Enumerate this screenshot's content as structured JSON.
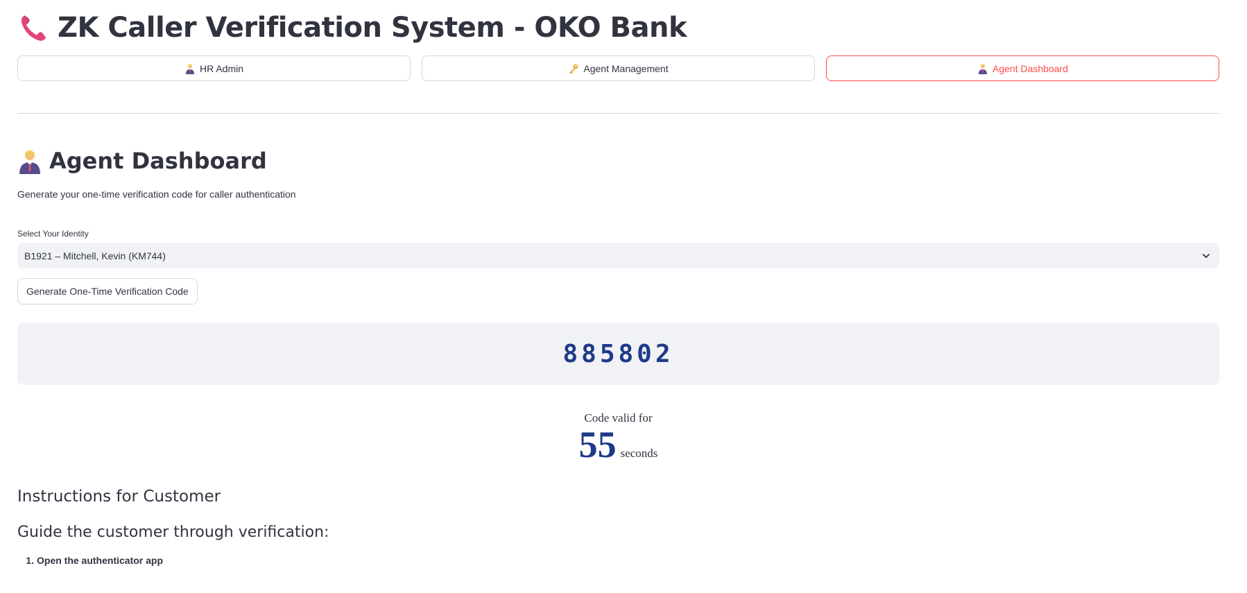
{
  "app": {
    "title": "ZK Caller Verification System - OKO Bank",
    "title_icon": "telephone-receiver-icon"
  },
  "nav": {
    "tabs": [
      {
        "label": "HR Admin",
        "icon": "person-office-worker-icon",
        "active": false
      },
      {
        "label": "Agent Management",
        "icon": "key-icon",
        "active": false
      },
      {
        "label": "Agent Dashboard",
        "icon": "person-office-worker-icon",
        "active": true
      }
    ]
  },
  "dashboard": {
    "title": "Agent Dashboard",
    "title_icon": "person-office-worker-icon",
    "subtitle": "Generate your one-time verification code for caller authentication",
    "identity": {
      "label": "Select Your Identity",
      "selected": "B1921 – Mitchell, Kevin (KM744)"
    },
    "generate_button": "Generate One-Time Verification Code",
    "code": "885802",
    "timer": {
      "label": "Code valid for",
      "value": "55",
      "unit": "seconds"
    }
  },
  "instructions": {
    "heading": "Instructions for Customer",
    "subheading": "Guide the customer through verification:",
    "steps": [
      "Open the authenticator app"
    ]
  },
  "colors": {
    "accent": "#ff4b4b",
    "code_text": "#1e3a8a",
    "panel_bg": "#f0f2f6",
    "text": "#31333f"
  }
}
